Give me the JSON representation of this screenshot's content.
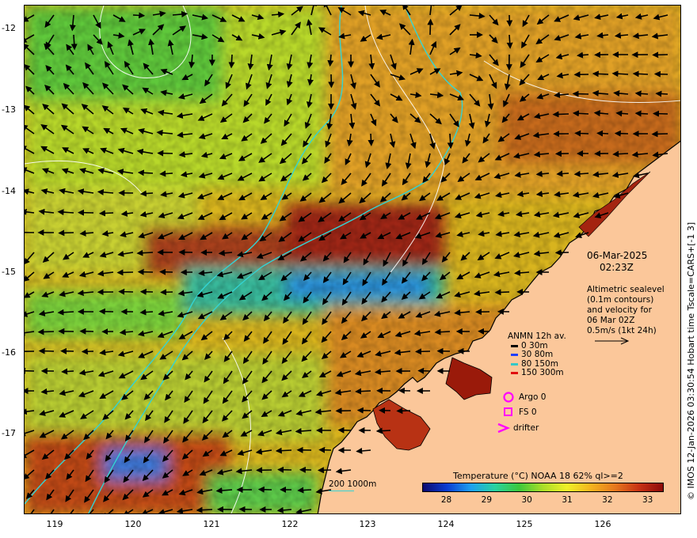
{
  "map": {
    "lon_ticks": [
      "119",
      "120",
      "121",
      "122",
      "123",
      "124",
      "125",
      "126"
    ],
    "lat_ticks": [
      "-12",
      "-13",
      "-14",
      "-15",
      "-16",
      "-17"
    ],
    "lon_range": [
      118.6,
      126.9
    ],
    "lat_range": [
      -11.95,
      -18.0
    ],
    "colors": {
      "land": "#fbc79a",
      "coastline": "#000000",
      "isobath": "#33d4d4",
      "contour": "#ffffff",
      "vector": "#000000"
    }
  },
  "date": "06-Mar-2025",
  "time": "02:23Z",
  "altimetry": {
    "lines": [
      "Altimetric sealevel",
      "(0.1m contours)",
      "and velocity for",
      "06 Mar 02Z",
      "0.5m/s (1kt 24h)"
    ]
  },
  "anmn_legend": {
    "title": "ANMN 12h av.",
    "items": [
      {
        "label": "0 30m",
        "color": "#000000"
      },
      {
        "label": "30 80m",
        "color": "#1f3fff"
      },
      {
        "label": "80 150m",
        "color": "#34c8c8"
      },
      {
        "label": "150 300m",
        "color": "#e01010"
      }
    ]
  },
  "markers": {
    "argo": {
      "label": "Argo 0",
      "color": "#ff00ff",
      "icon": "circle"
    },
    "fs": {
      "label": "FS 0",
      "color": "#ff00ff",
      "icon": "square"
    },
    "drifter": {
      "label": "drifter",
      "color": "#ff00ff",
      "icon": "chevron"
    }
  },
  "depth_scale": "200  1000m",
  "colorbar": {
    "title": "Temperature (°C) NOAA 18 62% ql>=2",
    "ticks": [
      "28",
      "29",
      "30",
      "31",
      "32",
      "33"
    ],
    "range": [
      27.4,
      33.4
    ],
    "stops": [
      "#0a0a6e",
      "#0a3cd2",
      "#1ea0f0",
      "#28d2a0",
      "#3cc83c",
      "#aade28",
      "#f0f028",
      "#f5b41e",
      "#e6781e",
      "#c83214",
      "#8c0a0a"
    ]
  },
  "credit": "© IMOS 12-Jan-2026 03:30:54 Hobart time Tscale=CARS+[-1 3]"
}
